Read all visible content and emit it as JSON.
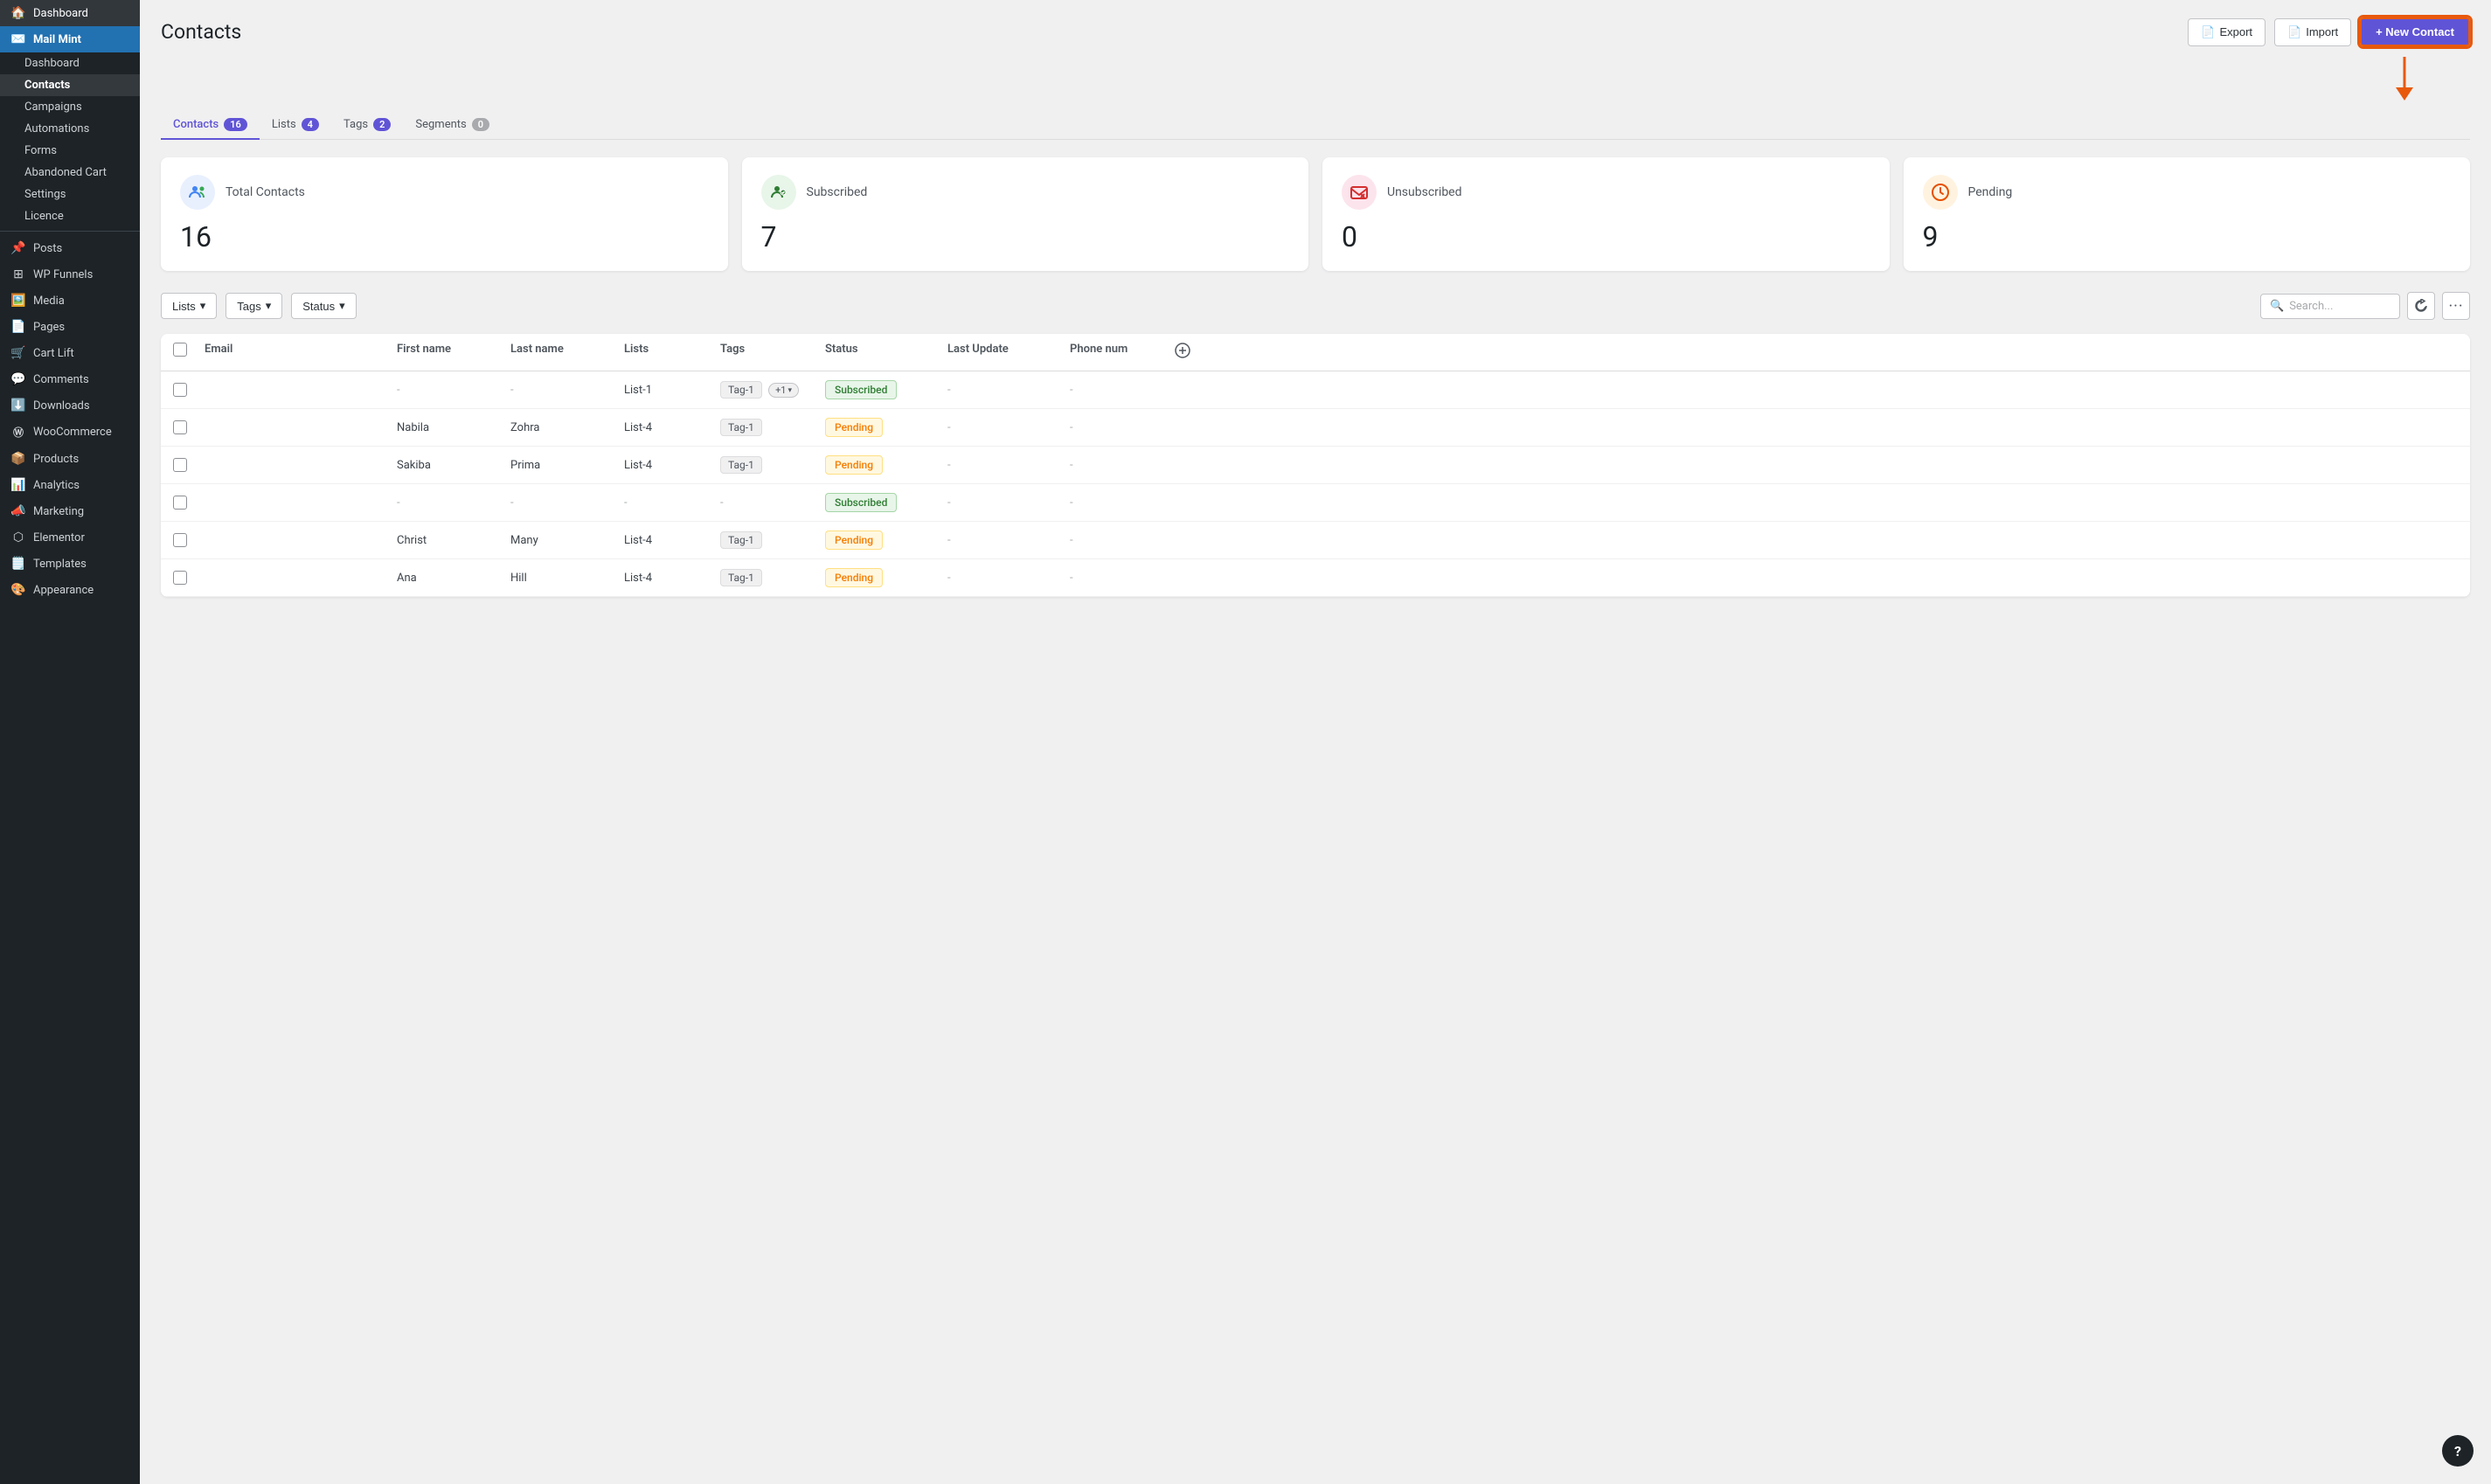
{
  "sidebar": {
    "top_plugin": "Mail Mint",
    "wp_items": [
      {
        "id": "dashboard",
        "label": "Dashboard",
        "icon": "🏠"
      },
      {
        "id": "mail-mint",
        "label": "Mail Mint",
        "icon": "✉️",
        "active": true
      },
      {
        "id": "posts",
        "label": "Posts",
        "icon": "📌"
      },
      {
        "id": "wp-funnels",
        "label": "WP Funnels",
        "icon": "⊞"
      },
      {
        "id": "media",
        "label": "Media",
        "icon": "🖼️"
      },
      {
        "id": "pages",
        "label": "Pages",
        "icon": "📄"
      },
      {
        "id": "cart-lift",
        "label": "Cart Lift",
        "icon": "🛒"
      },
      {
        "id": "comments",
        "label": "Comments",
        "icon": "💬"
      },
      {
        "id": "downloads",
        "label": "Downloads",
        "icon": "⬇️"
      },
      {
        "id": "woocommerce",
        "label": "WooCommerce",
        "icon": "Ⓦ"
      },
      {
        "id": "products",
        "label": "Products",
        "icon": "📦"
      },
      {
        "id": "analytics",
        "label": "Analytics",
        "icon": "📊"
      },
      {
        "id": "marketing",
        "label": "Marketing",
        "icon": "📣"
      },
      {
        "id": "elementor",
        "label": "Elementor",
        "icon": "⬡"
      },
      {
        "id": "templates",
        "label": "Templates",
        "icon": "🗒️"
      },
      {
        "id": "appearance",
        "label": "Appearance",
        "icon": "🎨"
      }
    ],
    "mail_mint_submenu": [
      {
        "id": "mm-dashboard",
        "label": "Dashboard"
      },
      {
        "id": "mm-contacts",
        "label": "Contacts",
        "current": true
      },
      {
        "id": "mm-campaigns",
        "label": "Campaigns"
      },
      {
        "id": "mm-automations",
        "label": "Automations"
      },
      {
        "id": "mm-forms",
        "label": "Forms"
      },
      {
        "id": "mm-abandoned-cart",
        "label": "Abandoned Cart"
      },
      {
        "id": "mm-settings",
        "label": "Settings"
      },
      {
        "id": "mm-licence",
        "label": "Licence"
      }
    ]
  },
  "page": {
    "title": "Contacts",
    "export_label": "Export",
    "import_label": "Import",
    "new_contact_label": "+ New Contact"
  },
  "tabs": [
    {
      "id": "contacts",
      "label": "Contacts",
      "badge": "16",
      "badge_color": "purple",
      "active": true
    },
    {
      "id": "lists",
      "label": "Lists",
      "badge": "4",
      "badge_color": "purple"
    },
    {
      "id": "tags",
      "label": "Tags",
      "badge": "2",
      "badge_color": "purple"
    },
    {
      "id": "segments",
      "label": "Segments",
      "badge": "0",
      "badge_color": "gray"
    }
  ],
  "stats": [
    {
      "id": "total-contacts",
      "label": "Total Contacts",
      "value": "16",
      "icon_color": "#e8f0fe",
      "icon": "👥"
    },
    {
      "id": "subscribed",
      "label": "Subscribed",
      "value": "7",
      "icon_color": "#e8f5e9",
      "icon": "👤"
    },
    {
      "id": "unsubscribed",
      "label": "Unsubscribed",
      "value": "0",
      "icon_color": "#fce4ec",
      "icon": "✉️"
    },
    {
      "id": "pending",
      "label": "Pending",
      "value": "9",
      "icon_color": "#fff3e0",
      "icon": "⏰"
    }
  ],
  "filters": {
    "lists_label": "Lists",
    "tags_label": "Tags",
    "status_label": "Status",
    "search_placeholder": "Search...",
    "chevron": "▾"
  },
  "table": {
    "columns": [
      "",
      "Email",
      "First name",
      "Last name",
      "Lists",
      "Tags",
      "Status",
      "Last Update",
      "Phone num",
      ""
    ],
    "rows": [
      {
        "email": "",
        "first": "-",
        "last": "-",
        "list": "List-1",
        "tag": "Tag-1",
        "tag_more": "+1",
        "status": "Subscribed",
        "last_update": "-",
        "phone": "-"
      },
      {
        "email": "",
        "first": "Nabila",
        "last": "Zohra",
        "list": "List-4",
        "tag": "Tag-1",
        "tag_more": "",
        "status": "Pending",
        "last_update": "-",
        "phone": "-"
      },
      {
        "email": "",
        "first": "Sakiba",
        "last": "Prima",
        "list": "List-4",
        "tag": "Tag-1",
        "tag_more": "",
        "status": "Pending",
        "last_update": "-",
        "phone": "-"
      },
      {
        "email": "",
        "first": "-",
        "last": "-",
        "list": "-",
        "tag": "-",
        "tag_more": "",
        "status": "Subscribed",
        "last_update": "-",
        "phone": "-"
      },
      {
        "email": "",
        "first": "Christ",
        "last": "Many",
        "list": "List-4",
        "tag": "Tag-1",
        "tag_more": "",
        "status": "Pending",
        "last_update": "-",
        "phone": "-"
      },
      {
        "email": "",
        "first": "Ana",
        "last": "Hill",
        "list": "List-4",
        "tag": "Tag-1",
        "tag_more": "",
        "status": "Pending",
        "last_update": "-",
        "phone": "-"
      }
    ]
  },
  "help_label": "?"
}
